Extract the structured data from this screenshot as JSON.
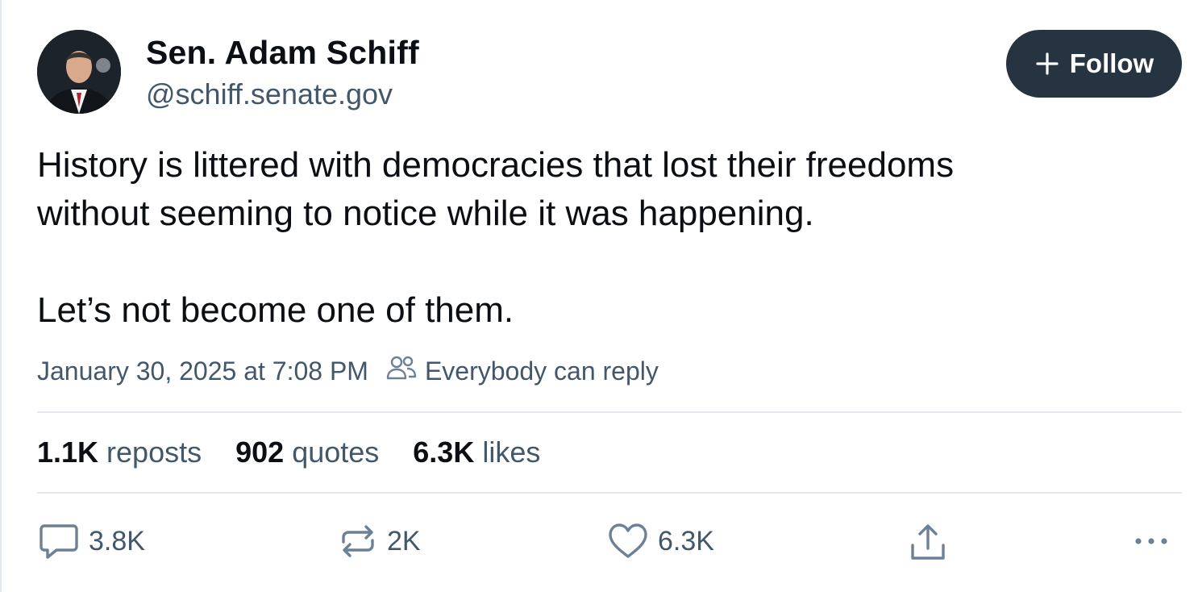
{
  "author": {
    "name": "Sen. Adam Schiff",
    "handle": "@schiff.senate.gov"
  },
  "follow_button": {
    "label": "Follow",
    "icon": "plus-icon"
  },
  "post": {
    "lines": [
      "History is littered with democracies that lost their freedoms",
      "without seeming to notice while it was happening.",
      "Let’s not become one of them."
    ]
  },
  "meta": {
    "timestamp": "January 30, 2025 at 7:08 PM",
    "reply_setting": "Everybody can reply",
    "reply_icon": "people-icon"
  },
  "stats": {
    "reposts": {
      "count": "1.1K",
      "label": "reposts"
    },
    "quotes": {
      "count": "902",
      "label": "quotes"
    },
    "likes": {
      "count": "6.3K",
      "label": "likes"
    }
  },
  "actions": {
    "reply": {
      "icon": "comment-icon",
      "count": "3.8K"
    },
    "repost": {
      "icon": "repost-icon",
      "count": "2K"
    },
    "like": {
      "icon": "heart-icon",
      "count": "6.3K"
    },
    "share": {
      "icon": "share-icon"
    },
    "more": {
      "icon": "more-dots-icon"
    }
  },
  "colors": {
    "text_primary": "#0b0f14",
    "text_secondary": "#42576c",
    "follow_button_bg": "#263341",
    "divider": "#e3e8ed",
    "icon_color": "#6c8198"
  }
}
